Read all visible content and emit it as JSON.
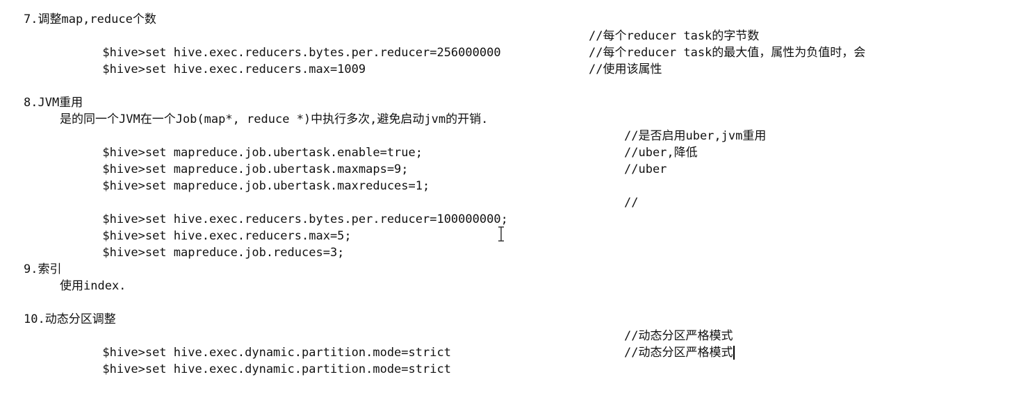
{
  "sections": [
    {
      "heading": "7.调整map,reduce个数",
      "lines": [
        {
          "cmd": "$hive>set hive.exec.reducers.bytes.per.reducer=256000000",
          "comment": "//每个reducer task的字节数"
        },
        {
          "cmd": "$hive>set hive.exec.reducers.max=1009",
          "comment": "//每个reducer task的最大值，属性为负值时，会"
        },
        {
          "cmd": "",
          "comment": "//使用该属性"
        }
      ]
    },
    {
      "heading": "8.JVM重用",
      "intro": "是的同一个JVM在一个Job(map*, reduce *)中执行多次,避免启动jvm的开销.",
      "lines": [
        {
          "cmd": "$hive>set mapreduce.job.ubertask.enable=true;",
          "comment": "//是否启用uber,jvm重用"
        },
        {
          "cmd": "$hive>set mapreduce.job.ubertask.maxmaps=9;",
          "comment": "//uber,降低"
        },
        {
          "cmd": "$hive>set mapreduce.job.ubertask.maxreduces=1;",
          "comment": "//uber"
        }
      ],
      "lines2": [
        {
          "cmd": "$hive>set hive.exec.reducers.bytes.per.reducer=100000000;",
          "comment": "//"
        },
        {
          "cmd": "$hive>set hive.exec.reducers.max=5;",
          "comment": ""
        },
        {
          "cmd": "$hive>set mapreduce.job.reduces=3;",
          "comment": ""
        }
      ]
    },
    {
      "heading": "9.索引",
      "intro": "使用index."
    },
    {
      "heading": "10.动态分区调整",
      "lines": [
        {
          "cmd": "$hive>set hive.exec.dynamic.partition.mode=strict",
          "comment": "//动态分区严格模式"
        },
        {
          "cmd": "$hive>set hive.exec.dynamic.partition.mode=strict",
          "comment": "//动态分区严格模式"
        }
      ]
    }
  ]
}
